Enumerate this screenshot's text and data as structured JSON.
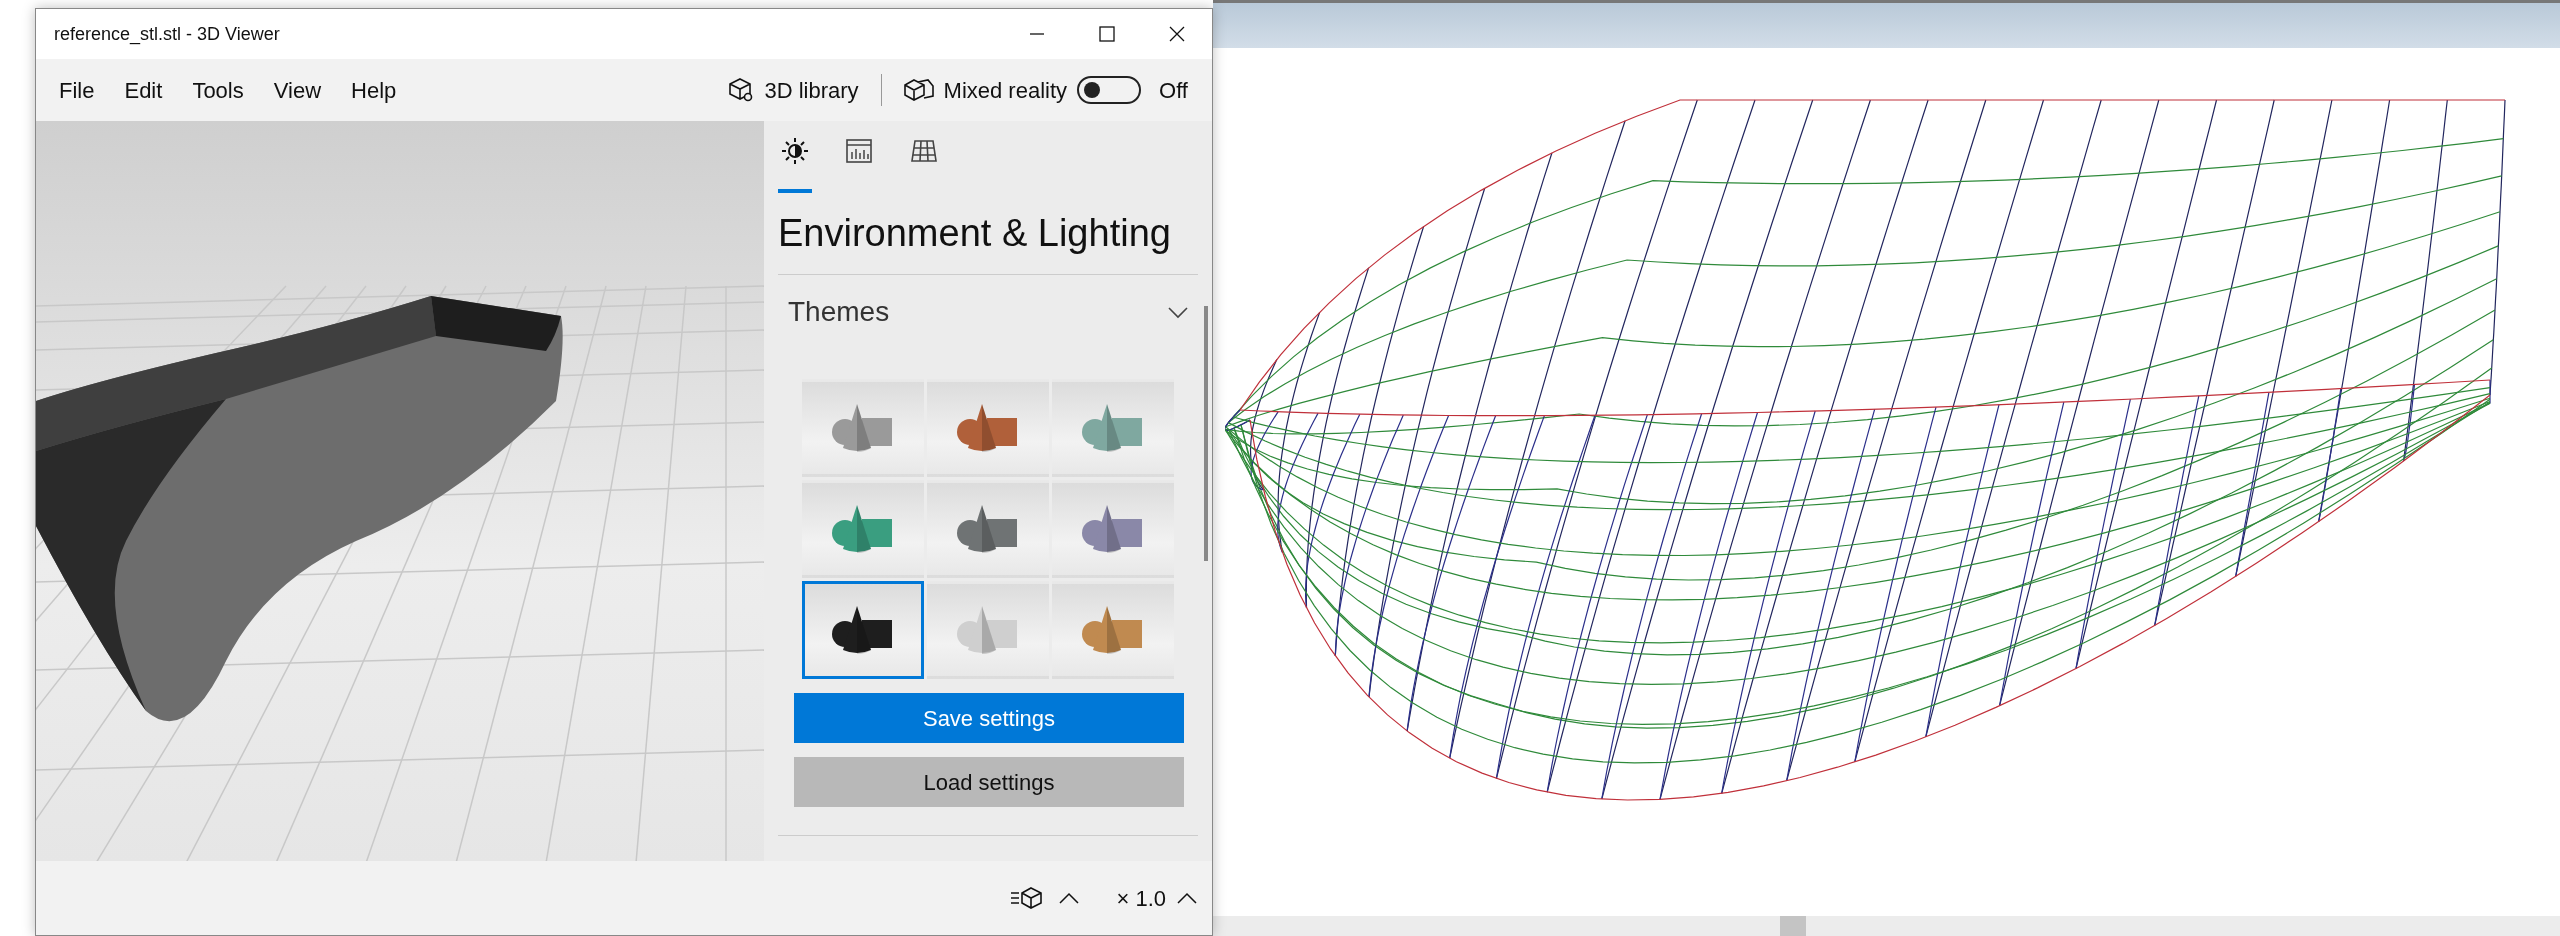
{
  "window": {
    "title": "reference_stl.stl - 3D Viewer"
  },
  "menu": [
    {
      "label": "File"
    },
    {
      "label": "Edit"
    },
    {
      "label": "Tools"
    },
    {
      "label": "View"
    },
    {
      "label": "Help"
    }
  ],
  "toolbar": {
    "library": "3D library",
    "mixed_reality": {
      "label": "Mixed reality",
      "on": false,
      "state_text": "Off"
    }
  },
  "panel": {
    "tabs": [
      {
        "kind": "lighting",
        "selected": true
      },
      {
        "kind": "stats",
        "selected": false
      },
      {
        "kind": "grid",
        "selected": false
      }
    ],
    "title": "Environment & Lighting",
    "section": {
      "title": "Themes",
      "expanded": true
    },
    "themes": [
      {
        "color": "#9a9a9a",
        "selected": false
      },
      {
        "color": "#b0603a",
        "selected": false
      },
      {
        "color": "#7fa8a0",
        "selected": false
      },
      {
        "color": "#3a9e80",
        "selected": false
      },
      {
        "color": "#6f7374",
        "selected": false
      },
      {
        "color": "#8a88a8",
        "selected": false
      },
      {
        "color": "#1e1e1e",
        "selected": true
      },
      {
        "color": "#cfcfcf",
        "selected": false
      },
      {
        "color": "#c08a50",
        "selected": false
      }
    ],
    "buttons": [
      {
        "label": "Save settings",
        "kind": "primary"
      },
      {
        "label": "Load settings",
        "kind": "secondary"
      }
    ]
  },
  "status_bar": {
    "zoom": "× 1.0"
  }
}
